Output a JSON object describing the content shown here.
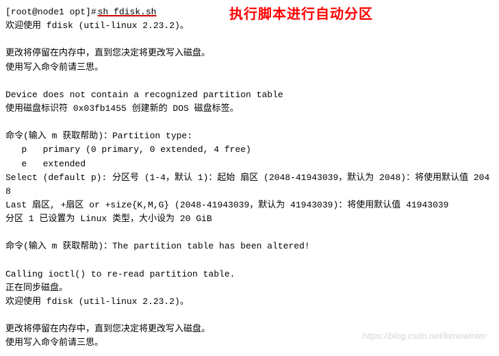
{
  "promptPrefix": "[root@node1 opt]#",
  "command": " sh fdisk.sh ",
  "welcome1": "欢迎使用 fdisk (util-linux 2.23.2)。",
  "annotation": "执行脚本进行自动分区",
  "blank": " ",
  "line3": "更改将停留在内存中，直到您决定将更改写入磁盘。",
  "line4": "使用写入命令前请三思。",
  "line6": "Device does not contain a recognized partition table",
  "line7": "使用磁盘标识符 0x03fb1455 创建新的 DOS 磁盘标签。",
  "line9": "命令(输入 m 获取帮助)：Partition type:",
  "line10": "   p   primary (0 primary, 0 extended, 4 free)",
  "line11": "   e   extended",
  "line12": "Select (default p): 分区号 (1-4，默认 1)：起始 扇区 (2048-41943039，默认为 2048)：将使用默认值 2048",
  "line13": "Last 扇区, +扇区 or +size{K,M,G} (2048-41943039，默认为 41943039)：将使用默认值 41943039",
  "line14": "分区 1 已设置为 Linux 类型，大小设为 20 GiB",
  "line16": "命令(输入 m 获取帮助)：The partition table has been altered!",
  "line18": "Calling ioctl() to re-read partition table.",
  "line19": "正在同步磁盘。",
  "line20": "欢迎使用 fdisk (util-linux 2.23.2)。",
  "line22": "更改将停留在内存中，直到您决定将更改写入磁盘。",
  "line23": "使用写入命令前请三思。",
  "watermark": "https://blog.csdn.net/kimowinter"
}
